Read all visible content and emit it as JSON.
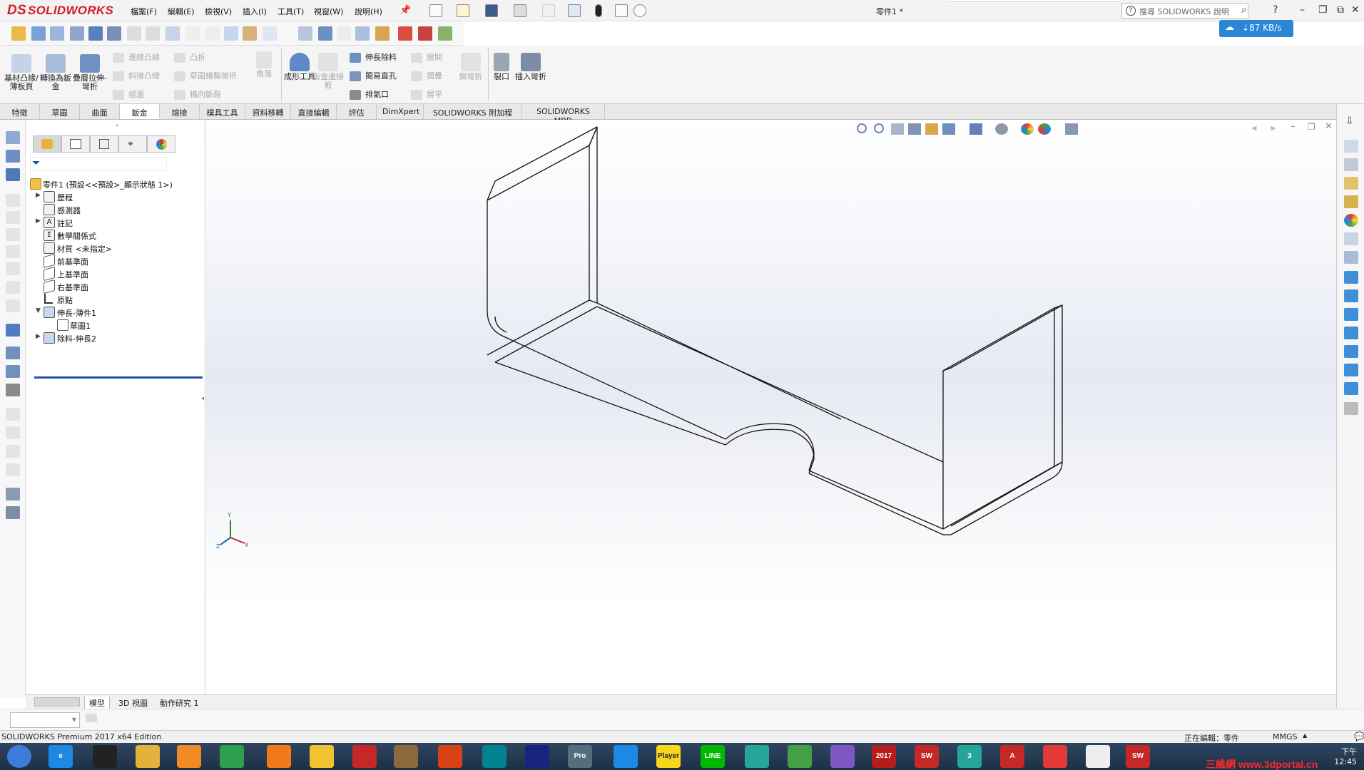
{
  "app": {
    "logo_prefix": "DS",
    "logo_text": "SOLIDWORKS",
    "document_title": "零件1 *",
    "search_placeholder": "搜尋 SOLIDWORKS 說明",
    "search_help_glyph": "?"
  },
  "menu": [
    "檔案(F)",
    "編輯(E)",
    "檢視(V)",
    "插入(I)",
    "工具(T)",
    "視窗(W)",
    "說明(H)"
  ],
  "speed_badge": "⇣87 KB/s",
  "ribbon": {
    "large_buttons": [
      {
        "label": "基材凸緣/薄板頁",
        "enabled": true
      },
      {
        "label": "轉換為鈑金",
        "enabled": true
      },
      {
        "label": "疊層拉伸-彎折",
        "enabled": true
      }
    ],
    "small_col1": [
      "邊線凸緣",
      "斜接凸緣",
      "摺邊"
    ],
    "small_col2": [
      "凸折",
      "草圖繪製彎折",
      "橫向斷裂"
    ],
    "corner_label": "角落",
    "forming_tool": "成形工具",
    "sheet_connector": "鈑金連接板",
    "small_col3": [
      "伸長除料",
      "簡易直孔",
      "排氣口"
    ],
    "small_col4": [
      "展開",
      "摺疊",
      "展平"
    ],
    "no_bends": "無彎折",
    "rip": "裂口",
    "insert_bends": "插入彎折"
  },
  "tabs": [
    {
      "label": "特徵",
      "active": false
    },
    {
      "label": "草圖",
      "active": false
    },
    {
      "label": "曲面",
      "active": false
    },
    {
      "label": "鈑金",
      "active": true
    },
    {
      "label": "熔接",
      "active": false
    },
    {
      "label": "模具工具",
      "active": false
    },
    {
      "label": "資料移轉",
      "active": false
    },
    {
      "label": "直接編輯",
      "active": false
    },
    {
      "label": "評估",
      "active": false
    },
    {
      "label": "DimXpert",
      "active": false
    },
    {
      "label": "SOLIDWORKS 附加程式",
      "active": false
    },
    {
      "label": "SOLIDWORKS MBD",
      "active": false
    }
  ],
  "feature_tree": {
    "root": "零件1 (預設<<預設>_顯示狀態 1>)",
    "items": [
      {
        "label": "歷程",
        "expandable": true,
        "expanded": false,
        "indent": 1
      },
      {
        "label": "感測器",
        "expandable": false,
        "indent": 1
      },
      {
        "label": "註記",
        "expandable": true,
        "expanded": false,
        "indent": 1
      },
      {
        "label": "數學關係式",
        "expandable": false,
        "indent": 1
      },
      {
        "label": "材質 <未指定>",
        "expandable": false,
        "indent": 1
      },
      {
        "label": "前基準面",
        "expandable": false,
        "indent": 1
      },
      {
        "label": "上基準面",
        "expandable": false,
        "indent": 1
      },
      {
        "label": "右基準面",
        "expandable": false,
        "indent": 1
      },
      {
        "label": "原點",
        "expandable": false,
        "indent": 1
      },
      {
        "label": "伸長-薄件1",
        "expandable": true,
        "expanded": true,
        "indent": 1
      },
      {
        "label": "草圖1",
        "expandable": false,
        "indent": 2
      },
      {
        "label": "除料-伸長2",
        "expandable": true,
        "expanded": false,
        "indent": 1
      }
    ]
  },
  "triad": {
    "x": "X",
    "y": "Y",
    "z": "Z"
  },
  "bottom_tabs": [
    {
      "label": "模型",
      "active": true
    },
    {
      "label": "3D 視圖",
      "active": false
    },
    {
      "label": "動作研究 1",
      "active": false
    }
  ],
  "status": {
    "edition": "SOLIDWORKS Premium 2017 x64 Edition",
    "editing": "正在編輯：零件",
    "units": "MMGS"
  },
  "taskbar": {
    "clock_line1": "下午 12:45",
    "watermark": "三維網 www.3dportal.cn",
    "apps": [
      {
        "name": "start",
        "color": "#3b7dd8",
        "label": ""
      },
      {
        "name": "ie",
        "color": "#1e88e5",
        "label": "e"
      },
      {
        "name": "qq",
        "color": "#222222",
        "label": ""
      },
      {
        "name": "explorer",
        "color": "#e6b13a",
        "label": ""
      },
      {
        "name": "media",
        "color": "#f08a24",
        "label": ""
      },
      {
        "name": "chrome",
        "color": "#2e9e4f",
        "label": ""
      },
      {
        "name": "ball",
        "color": "#f07a1a",
        "label": ""
      },
      {
        "name": "paint",
        "color": "#f2c230",
        "label": ""
      },
      {
        "name": "pdf",
        "color": "#c62828",
        "label": ""
      },
      {
        "name": "tool",
        "color": "#8a6a3a",
        "label": ""
      },
      {
        "name": "arc",
        "color": "#d84315",
        "label": ""
      },
      {
        "name": "mail",
        "color": "#00838f",
        "label": ""
      },
      {
        "name": "disk",
        "color": "#1a237e",
        "label": ""
      },
      {
        "name": "pro",
        "color": "#546e7a",
        "label": "Pro"
      },
      {
        "name": "baidu",
        "color": "#1e88e5",
        "label": ""
      },
      {
        "name": "player",
        "color": "#f9d71c",
        "label": "Player"
      },
      {
        "name": "line",
        "color": "#00b900",
        "label": "LINE"
      },
      {
        "name": "kite",
        "color": "#26a69a",
        "label": ""
      },
      {
        "name": "video",
        "color": "#43a047",
        "label": ""
      },
      {
        "name": "game",
        "color": "#7e57c2",
        "label": ""
      },
      {
        "name": "sw-2017a",
        "color": "#b71c1c",
        "label": "2017"
      },
      {
        "name": "sw-2017b",
        "color": "#c62828",
        "label": "SW"
      },
      {
        "name": "three",
        "color": "#26a69a",
        "label": "3"
      },
      {
        "name": "autocad",
        "color": "#c62828",
        "label": "A"
      },
      {
        "name": "sketchup",
        "color": "#e53935",
        "label": ""
      },
      {
        "name": "edit",
        "color": "#eeeeee",
        "label": ""
      },
      {
        "name": "sw-active",
        "color": "#c62828",
        "label": "SW"
      }
    ]
  },
  "colors": {
    "brand": "#d01f2a",
    "active_tab": "#ffffff",
    "rollback_bar": "#2450b0",
    "speed_badge": "#2a86d6"
  }
}
